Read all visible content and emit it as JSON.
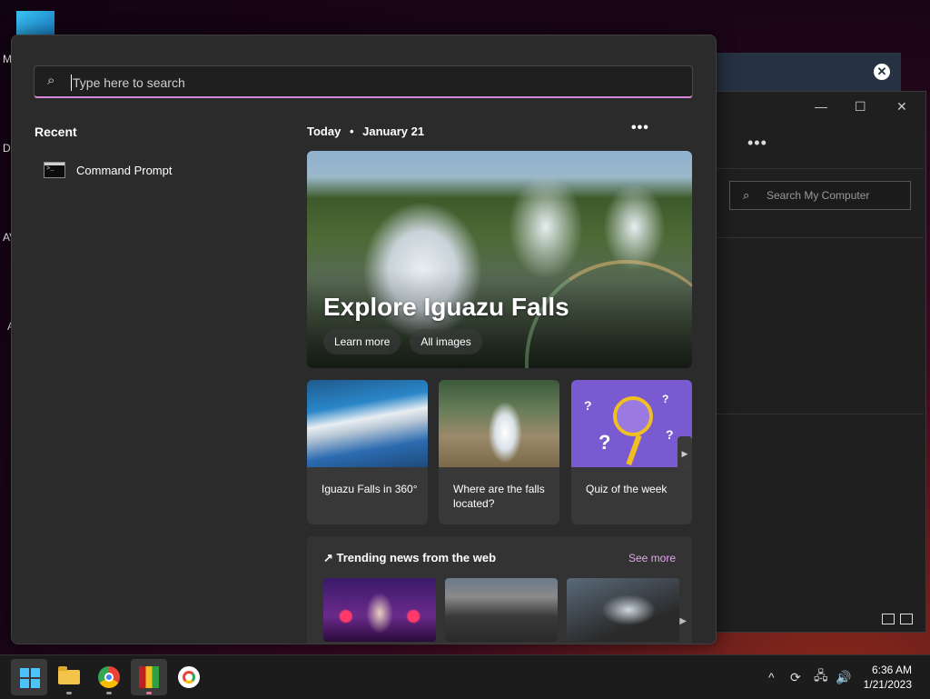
{
  "desktop": {
    "labels": [
      "M",
      "Da",
      "AV",
      "A"
    ]
  },
  "explorer": {
    "close_glyph": "✕",
    "min_glyph": "—",
    "max_glyph": "☐",
    "close_win_glyph": "✕",
    "more_glyph": "•••",
    "search_placeholder": "Search My Computer",
    "search_icon_glyph": "⌕"
  },
  "start": {
    "search": {
      "placeholder": "Type here to search",
      "icon_glyph": "⌕"
    },
    "recent": {
      "title": "Recent",
      "items": [
        {
          "label": "Command Prompt"
        }
      ]
    },
    "today": {
      "label": "Today",
      "dot": "•",
      "date": "January 21",
      "more_glyph": "•••"
    },
    "hero": {
      "title": "Explore Iguazu Falls",
      "buttons": [
        "Learn more",
        "All images"
      ]
    },
    "cards": [
      {
        "text": "Iguazu Falls in 360°"
      },
      {
        "text": "Where are the falls located?"
      },
      {
        "text": "Quiz of the week"
      }
    ],
    "cards_next_glyph": "▶",
    "trending": {
      "title": "↗ Trending news from the web",
      "see_more": "See more",
      "next_glyph": "▶"
    }
  },
  "taskbar": {
    "tray": {
      "overflow_glyph": "^",
      "sync_glyph": "⟳",
      "network_glyph": "🖧",
      "volume_glyph": "🔊"
    },
    "clock": {
      "time": "6:36 AM",
      "date": "1/21/2023"
    }
  }
}
